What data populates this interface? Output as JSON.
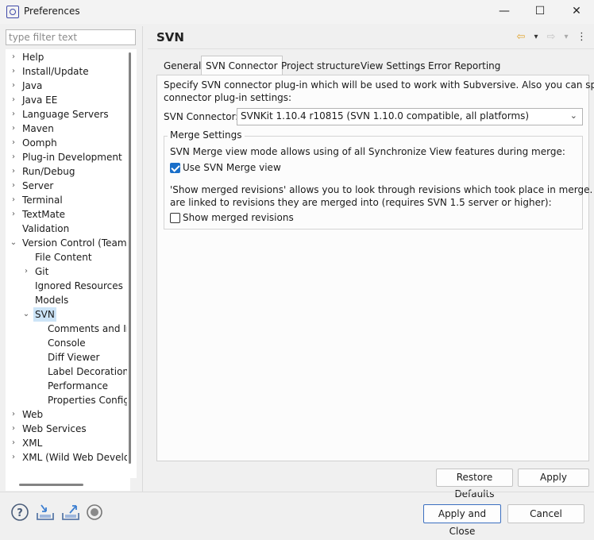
{
  "window": {
    "title": "Preferences",
    "minimize": "—",
    "maximize": "☐",
    "close": "✕"
  },
  "filter": {
    "placeholder": "type filter text"
  },
  "tree": [
    {
      "label": "Help",
      "arrow": "›"
    },
    {
      "label": "Install/Update",
      "arrow": "›"
    },
    {
      "label": "Java",
      "arrow": "›"
    },
    {
      "label": "Java EE",
      "arrow": "›"
    },
    {
      "label": "Language Servers",
      "arrow": "›"
    },
    {
      "label": "Maven",
      "arrow": "›"
    },
    {
      "label": "Oomph",
      "arrow": "›"
    },
    {
      "label": "Plug-in Development",
      "arrow": "›"
    },
    {
      "label": "Run/Debug",
      "arrow": "›"
    },
    {
      "label": "Server",
      "arrow": "›"
    },
    {
      "label": "Terminal",
      "arrow": "›"
    },
    {
      "label": "TextMate",
      "arrow": "›"
    },
    {
      "label": "Validation",
      "arrow": ""
    },
    {
      "label": "Version Control (Team)",
      "arrow": "⌄"
    },
    {
      "label": "File Content",
      "arrow": ""
    },
    {
      "label": "Git",
      "arrow": "›"
    },
    {
      "label": "Ignored Resources",
      "arrow": ""
    },
    {
      "label": "Models",
      "arrow": ""
    },
    {
      "label": "SVN",
      "arrow": "⌄"
    },
    {
      "label": "Comments and In",
      "arrow": ""
    },
    {
      "label": "Console",
      "arrow": ""
    },
    {
      "label": "Diff Viewer",
      "arrow": ""
    },
    {
      "label": "Label Decorations",
      "arrow": ""
    },
    {
      "label": "Performance",
      "arrow": ""
    },
    {
      "label": "Properties Configu",
      "arrow": ""
    },
    {
      "label": "Web",
      "arrow": "›"
    },
    {
      "label": "Web Services",
      "arrow": "›"
    },
    {
      "label": "XML",
      "arrow": "›"
    },
    {
      "label": "XML (Wild Web Develop",
      "arrow": "›"
    }
  ],
  "page": {
    "title": "SVN",
    "back": "⇦",
    "forward": "⇨",
    "dropdown": "▾",
    "menu": "⋮"
  },
  "tabs": [
    "General",
    "SVN Connector",
    "Project structure",
    "View Settings",
    "Error Reporting"
  ],
  "connector": {
    "description_line1": "Specify SVN connector plug-in which will be used to work with Subversive. Also you can specify",
    "description_line2": "connector plug-in settings:",
    "label": "SVN Connector:",
    "value": "SVNKit 1.10.4 r10815 (SVN 1.10.0 compatible, all platforms)",
    "arrow": "⌄"
  },
  "merge": {
    "legend": "Merge Settings",
    "description": "SVN Merge view mode allows using of all Synchronize View features during merge:",
    "use_merge_view_label": "Use SVN Merge view",
    "use_merge_view_checked": true,
    "show_merged_line1": "'Show merged revisions' allows you to look through revisions which took place in merge. They",
    "show_merged_line2": "are linked to revisions they are merged into (requires SVN 1.5 server or higher):",
    "show_merged_label": "Show merged revisions",
    "show_merged_checked": false
  },
  "buttons": {
    "restore_defaults": "Restore Defaults",
    "apply": "Apply",
    "apply_and_close": "Apply and Close",
    "cancel": "Cancel"
  },
  "colors": {
    "accent": "#1a6fc9",
    "selection": "#cce4f7",
    "back_arrow": "#e8b23a"
  }
}
